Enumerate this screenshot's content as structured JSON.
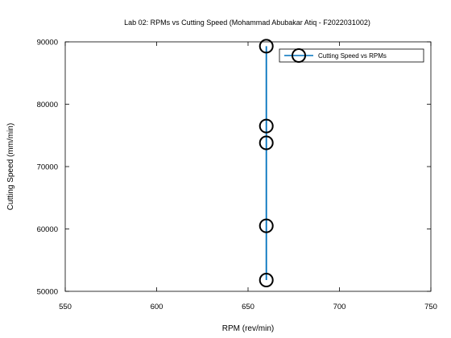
{
  "chart_data": {
    "type": "line",
    "title": "Lab 02: RPMs vs Cutting Speed (Mohammad Abubakar Atiq - F2022031002)",
    "xlabel": "RPM (rev/min)",
    "ylabel": "Cutting Speed (mm/min)",
    "xlim": [
      550,
      750
    ],
    "ylim": [
      50000,
      90000
    ],
    "xticks": [
      550,
      600,
      650,
      700,
      750
    ],
    "yticks": [
      50000,
      60000,
      70000,
      80000,
      90000
    ],
    "grid": false,
    "legend_position": "top-right",
    "series": [
      {
        "name": "Cutting Speed vs RPMs",
        "color": "#0072bd",
        "marker": "circle",
        "marker_color": "#000000",
        "x": [
          660,
          660,
          660,
          660,
          660
        ],
        "y": [
          89300,
          76500,
          73800,
          60500,
          51800
        ]
      }
    ]
  }
}
